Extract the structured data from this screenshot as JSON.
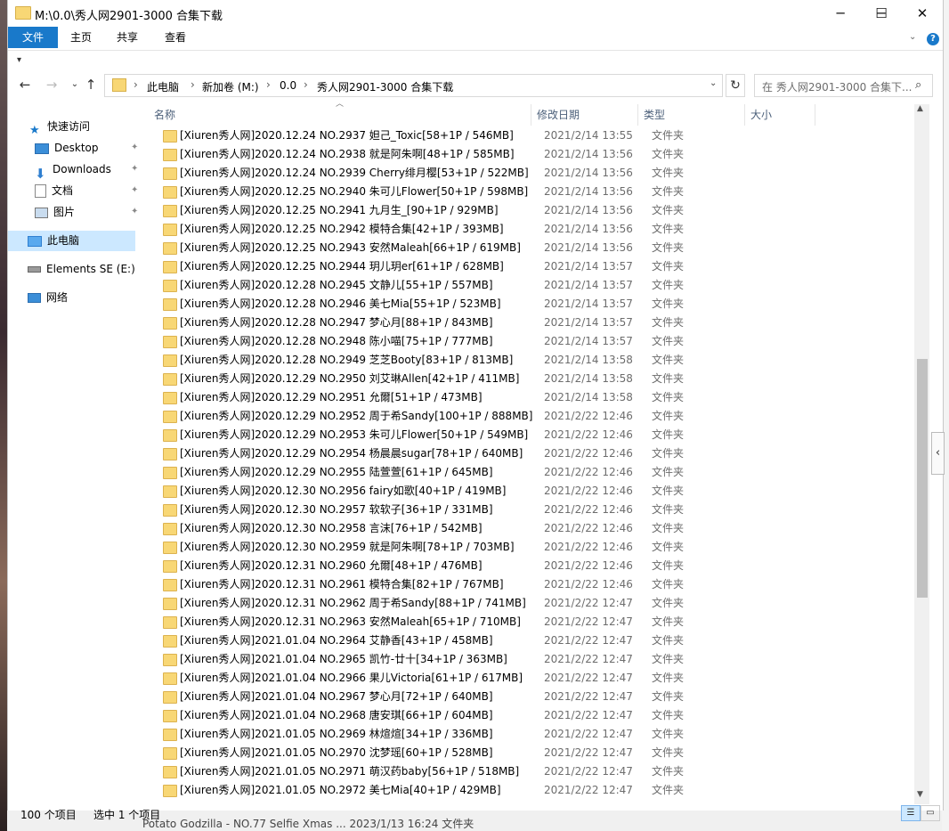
{
  "window": {
    "title": "M:\\0.0\\秀人网2901-3000 合集下载",
    "controls": {
      "minimize": "─",
      "maximize": "☐",
      "close": "✕"
    }
  },
  "ribbon": {
    "tabs": [
      "文件",
      "主页",
      "共享",
      "查看"
    ],
    "active_tab": "文件",
    "accent": "#1979ca",
    "help_label": "?"
  },
  "quick_access_toolbar": {
    "icon": "dropdown-icon"
  },
  "address_bar": {
    "breadcrumbs": [
      "此电脑",
      "新加卷 (M:)",
      "0.0",
      "秀人网2901-3000 合集下载"
    ],
    "separator": "›"
  },
  "search": {
    "placeholder": "在 秀人网2901-3000 合集下..."
  },
  "nav_pane": {
    "items": [
      {
        "label": "快速访问",
        "icon": "star-icon"
      },
      {
        "label": "Desktop",
        "icon": "desktop-icon",
        "pinned": true
      },
      {
        "label": "Downloads",
        "icon": "download-icon",
        "pinned": true
      },
      {
        "label": "文档",
        "icon": "document-icon",
        "pinned": true
      },
      {
        "label": "图片",
        "icon": "picture-icon",
        "pinned": true
      },
      {
        "label": "此电脑",
        "icon": "computer-icon",
        "selected": true
      },
      {
        "label": "Elements SE (E:)",
        "icon": "drive-icon"
      },
      {
        "label": "网络",
        "icon": "network-icon"
      }
    ]
  },
  "columns": [
    "名称",
    "修改日期",
    "类型",
    "大小"
  ],
  "files": [
    {
      "name": "[Xiuren秀人网]2020.12.24 NO.2937 妲己_Toxic[58+1P / 546MB]",
      "date": "2021/2/14 13:55",
      "type": "文件夹"
    },
    {
      "name": "[Xiuren秀人网]2020.12.24 NO.2938 就是阿朱啊[48+1P / 585MB]",
      "date": "2021/2/14 13:56",
      "type": "文件夹"
    },
    {
      "name": "[Xiuren秀人网]2020.12.24 NO.2939 Cherry绯月樱[53+1P / 522MB]",
      "date": "2021/2/14 13:56",
      "type": "文件夹"
    },
    {
      "name": "[Xiuren秀人网]2020.12.25 NO.2940 朱可儿Flower[50+1P / 598MB]",
      "date": "2021/2/14 13:56",
      "type": "文件夹"
    },
    {
      "name": "[Xiuren秀人网]2020.12.25 NO.2941 九月生_[90+1P / 929MB]",
      "date": "2021/2/14 13:56",
      "type": "文件夹"
    },
    {
      "name": "[Xiuren秀人网]2020.12.25 NO.2942 模特合集[42+1P / 393MB]",
      "date": "2021/2/14 13:56",
      "type": "文件夹"
    },
    {
      "name": "[Xiuren秀人网]2020.12.25 NO.2943 安然Maleah[66+1P / 619MB]",
      "date": "2021/2/14 13:56",
      "type": "文件夹"
    },
    {
      "name": "[Xiuren秀人网]2020.12.25 NO.2944 玥儿玥er[61+1P / 628MB]",
      "date": "2021/2/14 13:57",
      "type": "文件夹"
    },
    {
      "name": "[Xiuren秀人网]2020.12.28 NO.2945 文静儿[55+1P / 557MB]",
      "date": "2021/2/14 13:57",
      "type": "文件夹"
    },
    {
      "name": "[Xiuren秀人网]2020.12.28 NO.2946 美七Mia[55+1P / 523MB]",
      "date": "2021/2/14 13:57",
      "type": "文件夹"
    },
    {
      "name": "[Xiuren秀人网]2020.12.28 NO.2947 梦心月[88+1P / 843MB]",
      "date": "2021/2/14 13:57",
      "type": "文件夹"
    },
    {
      "name": "[Xiuren秀人网]2020.12.28 NO.2948 陈小喵[75+1P / 777MB]",
      "date": "2021/2/14 13:57",
      "type": "文件夹"
    },
    {
      "name": "[Xiuren秀人网]2020.12.28 NO.2949 芝芝Booty[83+1P / 813MB]",
      "date": "2021/2/14 13:58",
      "type": "文件夹"
    },
    {
      "name": "[Xiuren秀人网]2020.12.29 NO.2950 刘艾琳Allen[42+1P / 411MB]",
      "date": "2021/2/14 13:58",
      "type": "文件夹"
    },
    {
      "name": "[Xiuren秀人网]2020.12.29 NO.2951 允爾[51+1P / 473MB]",
      "date": "2021/2/14 13:58",
      "type": "文件夹"
    },
    {
      "name": "[Xiuren秀人网]2020.12.29 NO.2952 周于希Sandy[100+1P / 888MB]",
      "date": "2021/2/22 12:46",
      "type": "文件夹"
    },
    {
      "name": "[Xiuren秀人网]2020.12.29 NO.2953 朱可儿Flower[50+1P / 549MB]",
      "date": "2021/2/22 12:46",
      "type": "文件夹"
    },
    {
      "name": "[Xiuren秀人网]2020.12.29 NO.2954 杨晨晨sugar[78+1P / 640MB]",
      "date": "2021/2/22 12:46",
      "type": "文件夹"
    },
    {
      "name": "[Xiuren秀人网]2020.12.29 NO.2955 陆萱萱[61+1P / 645MB]",
      "date": "2021/2/22 12:46",
      "type": "文件夹"
    },
    {
      "name": "[Xiuren秀人网]2020.12.30 NO.2956 fairy如歌[40+1P / 419MB]",
      "date": "2021/2/22 12:46",
      "type": "文件夹"
    },
    {
      "name": "[Xiuren秀人网]2020.12.30 NO.2957 软软子[36+1P / 331MB]",
      "date": "2021/2/22 12:46",
      "type": "文件夹"
    },
    {
      "name": "[Xiuren秀人网]2020.12.30 NO.2958 言沫[76+1P / 542MB]",
      "date": "2021/2/22 12:46",
      "type": "文件夹"
    },
    {
      "name": "[Xiuren秀人网]2020.12.30 NO.2959 就是阿朱啊[78+1P / 703MB]",
      "date": "2021/2/22 12:46",
      "type": "文件夹"
    },
    {
      "name": "[Xiuren秀人网]2020.12.31 NO.2960 允爾[48+1P / 476MB]",
      "date": "2021/2/22 12:46",
      "type": "文件夹"
    },
    {
      "name": "[Xiuren秀人网]2020.12.31 NO.2961 模特合集[82+1P / 767MB]",
      "date": "2021/2/22 12:46",
      "type": "文件夹"
    },
    {
      "name": "[Xiuren秀人网]2020.12.31 NO.2962 周于希Sandy[88+1P / 741MB]",
      "date": "2021/2/22 12:47",
      "type": "文件夹"
    },
    {
      "name": "[Xiuren秀人网]2020.12.31 NO.2963 安然Maleah[65+1P / 710MB]",
      "date": "2021/2/22 12:47",
      "type": "文件夹"
    },
    {
      "name": "[Xiuren秀人网]2021.01.04 NO.2964 艾静香[43+1P / 458MB]",
      "date": "2021/2/22 12:47",
      "type": "文件夹"
    },
    {
      "name": "[Xiuren秀人网]2021.01.04 NO.2965 凯竹-廿十[34+1P / 363MB]",
      "date": "2021/2/22 12:47",
      "type": "文件夹"
    },
    {
      "name": "[Xiuren秀人网]2021.01.04 NO.2966 果儿Victoria[61+1P / 617MB]",
      "date": "2021/2/22 12:47",
      "type": "文件夹"
    },
    {
      "name": "[Xiuren秀人网]2021.01.04 NO.2967 梦心月[72+1P / 640MB]",
      "date": "2021/2/22 12:47",
      "type": "文件夹"
    },
    {
      "name": "[Xiuren秀人网]2021.01.04 NO.2968 唐安琪[66+1P / 604MB]",
      "date": "2021/2/22 12:47",
      "type": "文件夹"
    },
    {
      "name": "[Xiuren秀人网]2021.01.05 NO.2969 林煊煊[34+1P / 336MB]",
      "date": "2021/2/22 12:47",
      "type": "文件夹"
    },
    {
      "name": "[Xiuren秀人网]2021.01.05 NO.2970 沈梦瑶[60+1P / 528MB]",
      "date": "2021/2/22 12:47",
      "type": "文件夹"
    },
    {
      "name": "[Xiuren秀人网]2021.01.05 NO.2971 萌汉药baby[56+1P / 518MB]",
      "date": "2021/2/22 12:47",
      "type": "文件夹"
    },
    {
      "name": "[Xiuren秀人网]2021.01.05 NO.2972 美七Mia[40+1P / 429MB]",
      "date": "2021/2/22 12:47",
      "type": "文件夹"
    }
  ],
  "status_bar": {
    "item_count": "100 个项目",
    "selection": "选中 1 个项目"
  },
  "background_window": {
    "partial_row": "Potato Godzilla - NO.77 Selfie Xmas ...   2023/1/13 16:24   文件夹"
  }
}
